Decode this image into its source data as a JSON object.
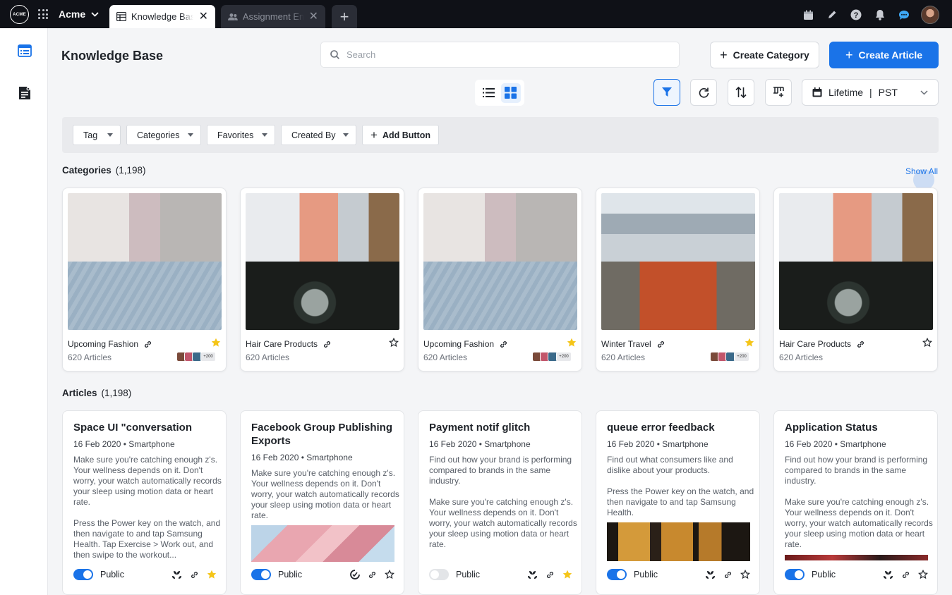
{
  "topbar": {
    "logo": "ACME",
    "org": "Acme",
    "tabs": [
      {
        "label": "Knowledge Base",
        "active": true
      },
      {
        "label": "Assignment Engine",
        "active": false
      }
    ]
  },
  "header": {
    "title": "Knowledge Base",
    "search_placeholder": "Search",
    "create_category": "Create Category",
    "create_article": "Create Article",
    "date_range": "Lifetime",
    "timezone": "PST"
  },
  "filters": {
    "tag": "Tag",
    "categories": "Categories",
    "favorites": "Favorites",
    "created_by": "Created By",
    "add_button": "Add Button"
  },
  "categories": {
    "title": "Categories",
    "count": "(1,198)",
    "show_all": "Show All",
    "items": [
      {
        "name": "Upcoming Fashion",
        "articles": "620 Articles",
        "starred": true,
        "more": "+200"
      },
      {
        "name": "Hair Care Products",
        "articles": "620 Articles",
        "starred": false,
        "more": ""
      },
      {
        "name": "Upcoming Fashion",
        "articles": "620 Articles",
        "starred": true,
        "more": "+200"
      },
      {
        "name": "Winter Travel",
        "articles": "620 Articles",
        "starred": true,
        "more": "+200"
      },
      {
        "name": "Hair Care Products",
        "articles": "620 Articles",
        "starred": false,
        "more": ""
      }
    ]
  },
  "articles": {
    "title": "Articles",
    "count": "(1,198)",
    "items": [
      {
        "title": "Space UI \"conversation",
        "meta": "16 Feb 2020 • Smartphone",
        "p1": "Make sure you're catching enough z's. Your wellness depends on it. Don't worry, your watch automatically records your sleep using motion data or heart rate.",
        "p2": "Press the Power key on the watch, and then navigate to and tap Samsung Health. Tap Exercise > Work out, and then swipe to the workout...",
        "visibility": "Public",
        "public": true,
        "starred": true
      },
      {
        "title": "Facebook Group Publishing Exports",
        "meta": "16 Feb 2020 • Smartphone",
        "p1": "Make sure you're catching enough z's. Your wellness depends on it. Don't worry, your watch automatically records your sleep using motion data or heart rate.",
        "p2": "",
        "visibility": "Public",
        "public": true,
        "starred": false
      },
      {
        "title": "Payment notif glitch",
        "meta": "16 Feb 2020 • Smartphone",
        "p1": "Find out how your brand is performing compared to brands in the same industry.",
        "p2": "Make sure you're catching enough z's. Your wellness depends on it. Don't worry, your watch automatically records your sleep using motion data or heart rate.",
        "visibility": "Public",
        "public": false,
        "starred": true
      },
      {
        "title": "queue error feedback",
        "meta": "16 Feb 2020 • Smartphone",
        "p1": "Find out what consumers like and dislike about your products.",
        "p2": "Press the Power key on the watch, and then navigate to and tap Samsung Health.",
        "visibility": "Public",
        "public": true,
        "starred": false
      },
      {
        "title": "Application Status",
        "meta": "16 Feb 2020 • Smartphone",
        "p1": "Find out how your brand is performing compared to brands in the same industry.",
        "p2": "Make sure you're catching enough z's. Your wellness depends on it. Don't worry, your watch automatically records your sleep using motion data or heart rate.",
        "visibility": "Public",
        "public": true,
        "starred": false
      }
    ]
  },
  "colors": {
    "accent": "#1a73e8",
    "star": "#f5c518",
    "topbar": "#0f1117"
  }
}
